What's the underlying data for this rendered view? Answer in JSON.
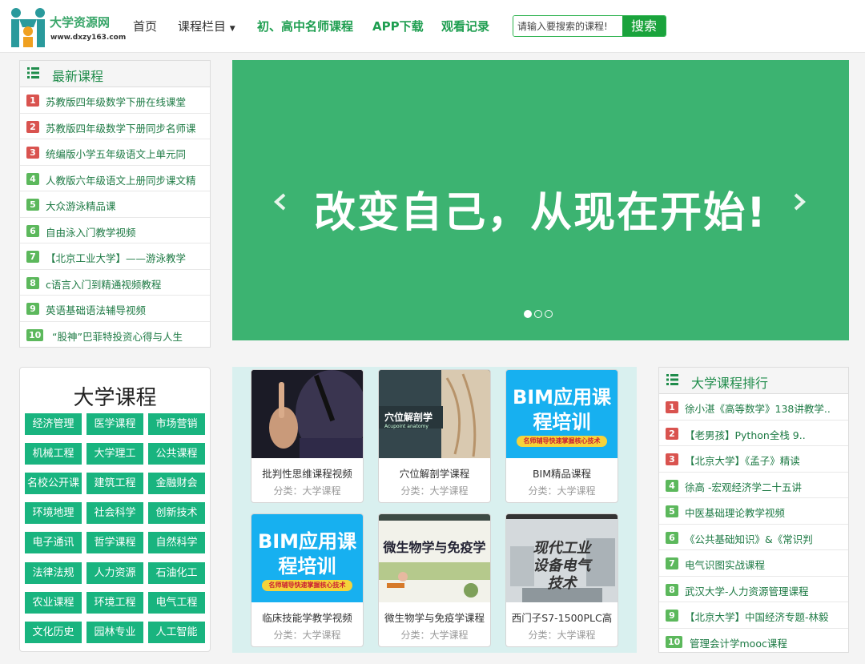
{
  "header": {
    "logo_text": "大学资源网",
    "logo_sub": "www.dxzy163.com",
    "nav": {
      "home": "首页",
      "columns": "课程栏目",
      "teachers": "初、高中名师课程",
      "app": "APP下载",
      "history": "观看记录"
    },
    "search_placeholder": "请输入要搜索的课程!",
    "search_button": "搜索"
  },
  "latest": {
    "title": "最新课程",
    "items": [
      {
        "num": "1",
        "text": "苏教版四年级数学下册在线课堂"
      },
      {
        "num": "2",
        "text": "苏教版四年级数学下册同步名师课"
      },
      {
        "num": "3",
        "text": "统编版小学五年级语文上单元同"
      },
      {
        "num": "4",
        "text": "人教版六年级语文上册同步课文精"
      },
      {
        "num": "5",
        "text": "大众游泳精品课"
      },
      {
        "num": "6",
        "text": "自由泳入门教学视频"
      },
      {
        "num": "7",
        "text": "【北京工业大学】——游泳教学"
      },
      {
        "num": "8",
        "text": "c语言入门到精通视频教程"
      },
      {
        "num": "9",
        "text": "英语基础语法辅导视频"
      },
      {
        "num": "10",
        "text": "“股神”巴菲特投资心得与人生"
      }
    ]
  },
  "banner": {
    "slogan": "改变自己，从现在开始!",
    "active_slide": 1,
    "slide_count": 3
  },
  "university": {
    "title": "大学课程",
    "tags": [
      "经济管理",
      "医学课程",
      "市场营销",
      "机械工程",
      "大学理工",
      "公共课程",
      "名校公开课",
      "建筑工程",
      "金融财会",
      "环境地理",
      "社会科学",
      "创新技术",
      "电子通讯",
      "哲学课程",
      "自然科学",
      "法律法规",
      "人力资源",
      "石油化工",
      "农业课程",
      "环境工程",
      "电气工程",
      "文化历史",
      "园林专业",
      "人工智能"
    ]
  },
  "cards": [
    {
      "title": "批判性思维课程视频",
      "category": "分类：大学课程"
    },
    {
      "title": "穴位解剖学课程",
      "category": "分类：大学课程",
      "cover_text": "穴位解剖学",
      "cover_sub": "Acupoint anatomy"
    },
    {
      "title": "BIM精品课程",
      "category": "分类：大学课程",
      "cover_l1": "BIM应用课",
      "cover_l2": "程培训",
      "cover_bar": "名师辅导快速掌握核心技术"
    },
    {
      "title": "临床技能学教学视频",
      "category": "分类：大学课程",
      "cover_l1": "BIM应用课",
      "cover_l2": "程培训",
      "cover_bar": "名师辅导快速掌握核心技术"
    },
    {
      "title": "微生物学与免疫学课程",
      "category": "分类：大学课程",
      "cover_text": "微生物学与免疫学"
    },
    {
      "title": "西门子S7-1500PLC高",
      "category": "分类：大学课程",
      "cover_l1": "现代工业",
      "cover_l2": "设备电气",
      "cover_l3": "技术"
    }
  ],
  "ranking": {
    "title": "大学课程排行",
    "items": [
      {
        "num": "1",
        "text": "徐小湛《高等数学》138讲教学.."
      },
      {
        "num": "2",
        "text": "【老男孩】Python全栈 9.."
      },
      {
        "num": "3",
        "text": "【北京大学】《孟子》精读"
      },
      {
        "num": "4",
        "text": "徐高 -宏观经济学二十五讲"
      },
      {
        "num": "5",
        "text": "中医基础理论教学视频"
      },
      {
        "num": "6",
        "text": "《公共基础知识》&《常识判"
      },
      {
        "num": "7",
        "text": "电气识图实战课程"
      },
      {
        "num": "8",
        "text": "武汉大学-人力资源管理课程"
      },
      {
        "num": "9",
        "text": "【北京大学】中国经济专题-林毅"
      },
      {
        "num": "10",
        "text": "管理会计学mooc课程"
      }
    ]
  },
  "colors": {
    "brand_green": "#3cb371",
    "accent": "#1aa33c",
    "rank_red": "#d9534f",
    "rank_green": "#5cb85c",
    "tag": "#19b47f"
  }
}
